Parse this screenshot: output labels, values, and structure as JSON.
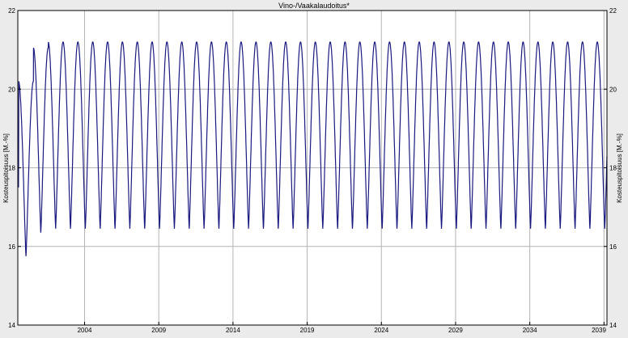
{
  "chart_data": {
    "type": "line",
    "title": "Vino-/Vaakalaudoitus*",
    "ylabel": "Kosteuspitoisuus [M.-%]",
    "ylabel_right": "Kosteuspitoisuus [M.-%]",
    "xlabel": "",
    "ylim": [
      14,
      22
    ],
    "yticks": [
      "14",
      "16",
      "18",
      "20",
      "22"
    ],
    "xlim": [
      1999.5,
      2039.2
    ],
    "xticks": [
      "2004",
      "2009",
      "2014",
      "2019",
      "2024",
      "2029",
      "2034",
      "2039"
    ],
    "grid": true,
    "line_color": "#1a1a80",
    "series": [
      {
        "x_start": 1999.55,
        "period_years": 1.0,
        "min_initial": 15.75,
        "max_initial": 20.2,
        "min_steady": 16.45,
        "max_steady": 21.2,
        "max_year2": 21.05,
        "min_year2": 16.35
      }
    ]
  }
}
